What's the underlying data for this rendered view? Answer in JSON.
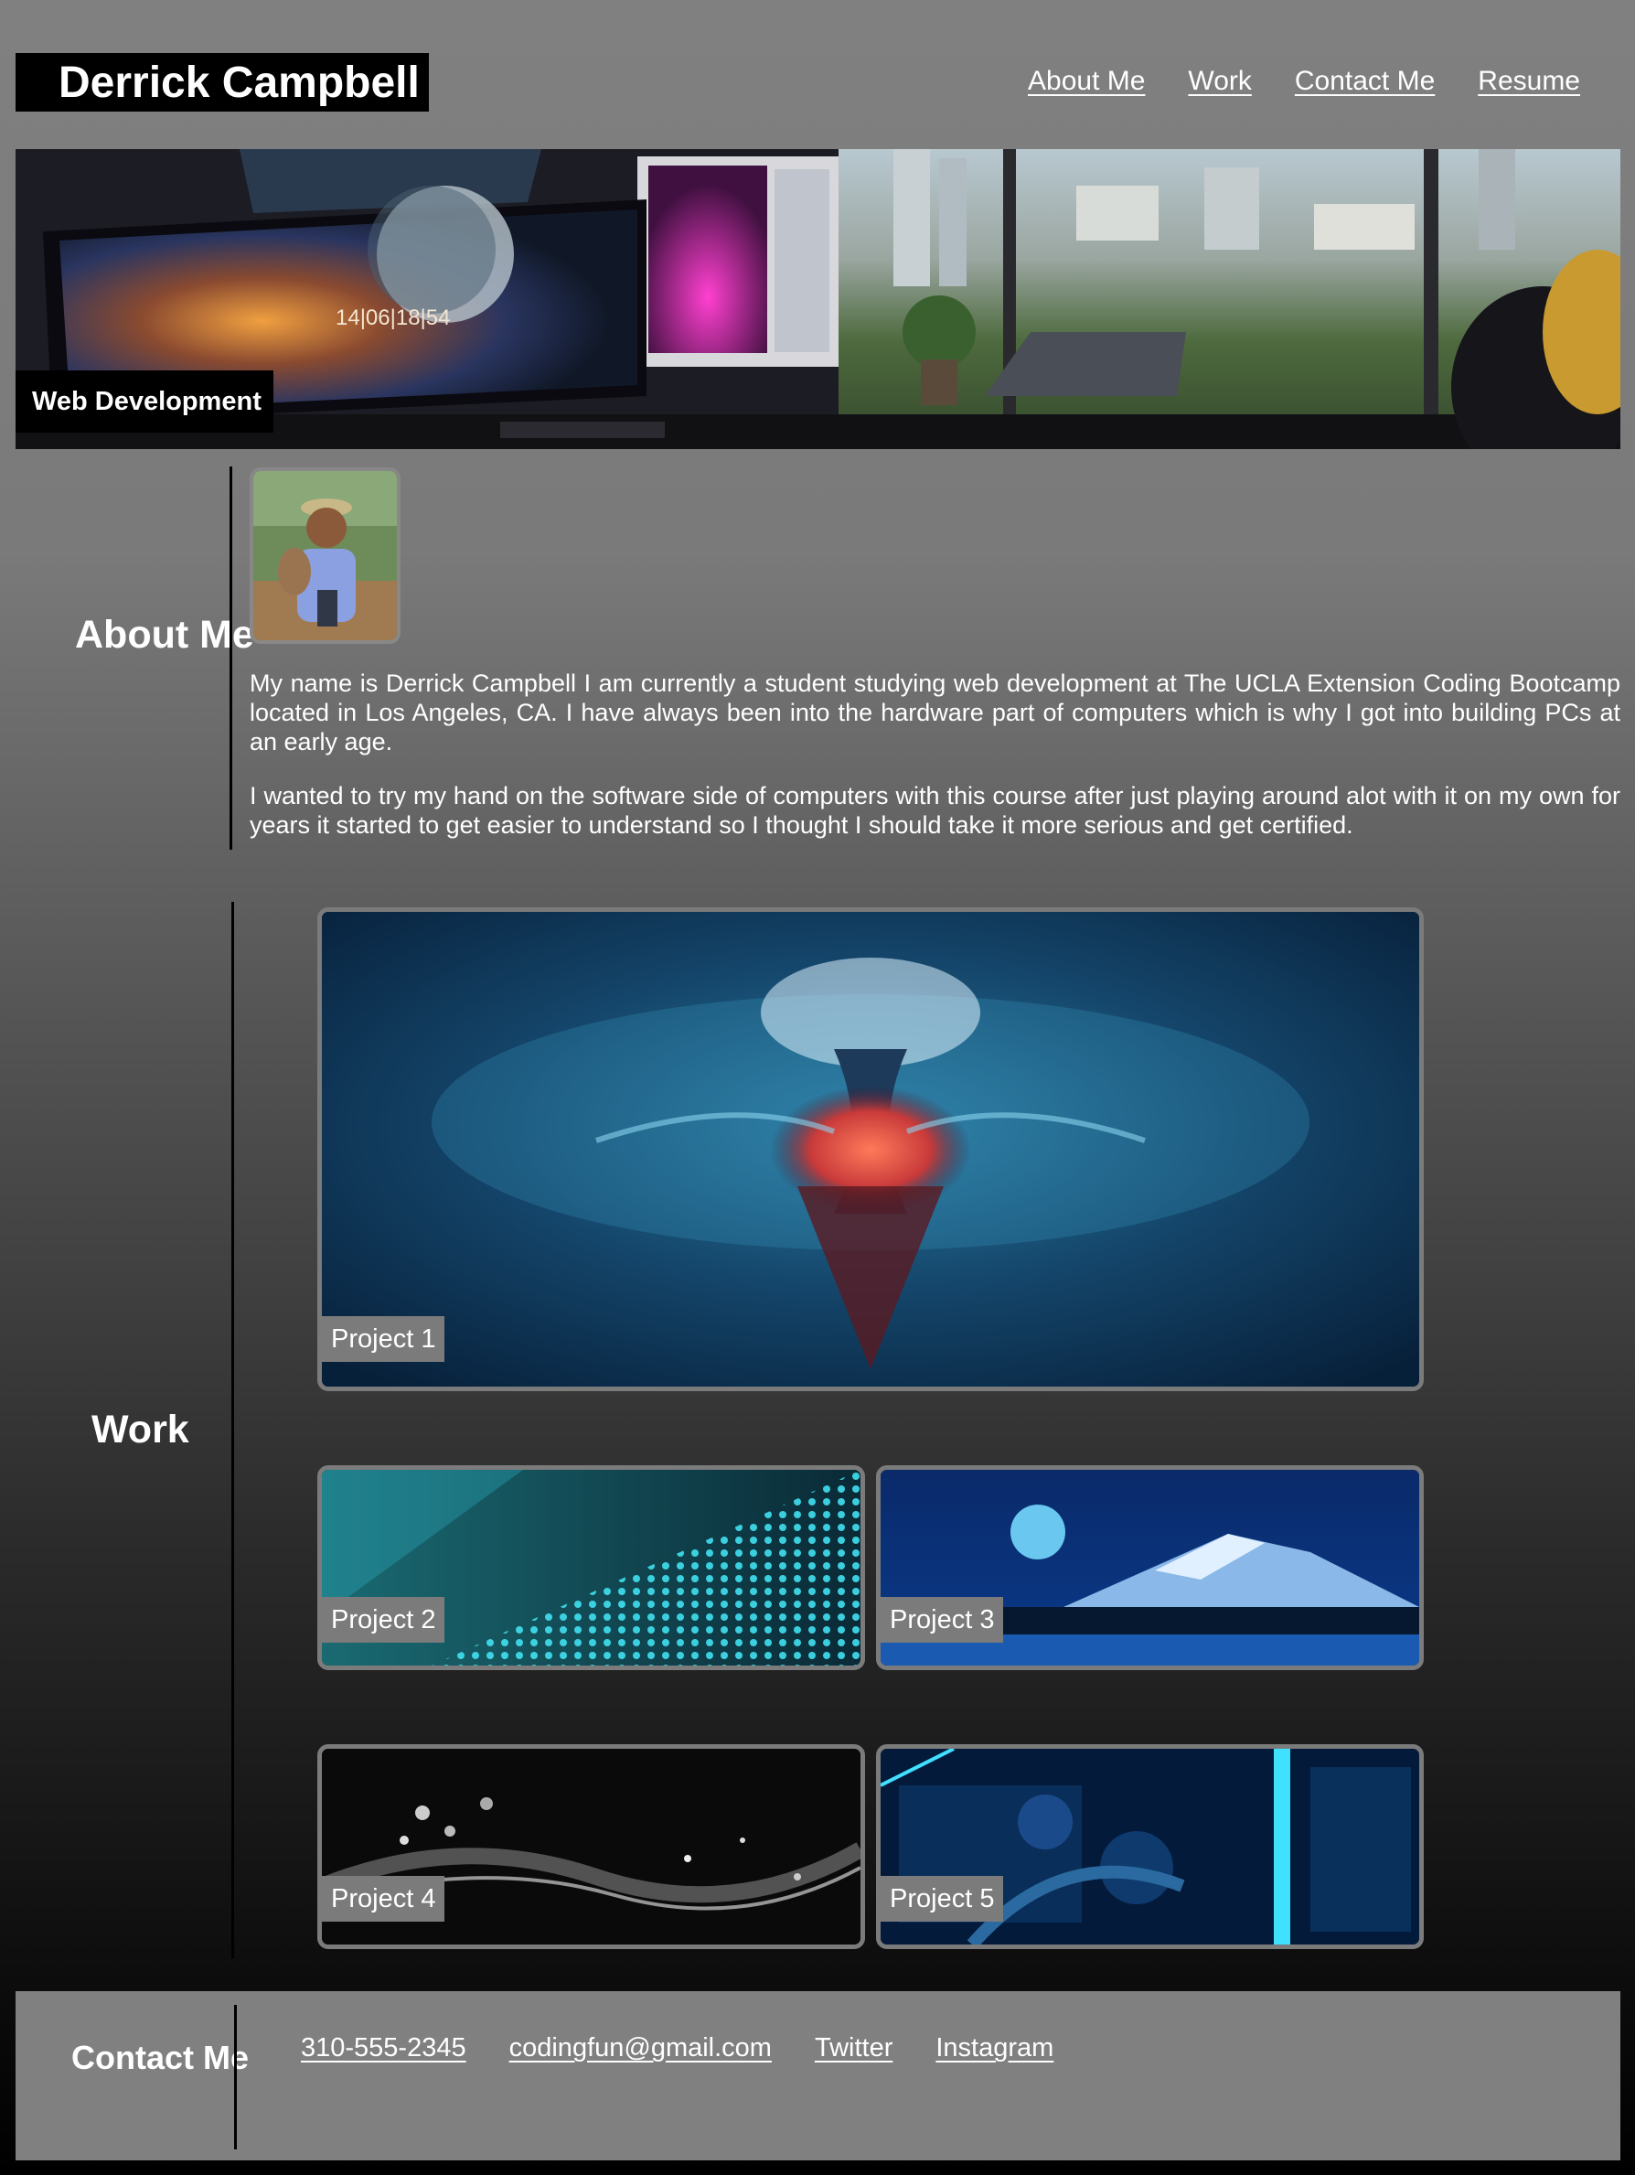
{
  "header": {
    "title": "Derrick Campbell",
    "nav": [
      "About Me",
      "Work",
      "Contact Me",
      "Resume"
    ]
  },
  "hero": {
    "label": "Web Development",
    "clock_text": "14|06|18|54"
  },
  "about": {
    "heading": "About Me",
    "paragraphs": [
      "My name is Derrick Campbell I am currently a student studying web development at The UCLA Extension Coding Bootcamp located in Los Angeles, CA. I have always been into the hardware part of computers which is why I got into building PCs at an early age.",
      "I wanted to try my hand on the software side of computers with this course after just playing around alot with it on my own for years it started to get easier to understand so I thought I should take it more serious and get certified."
    ]
  },
  "work": {
    "heading": "Work",
    "projects": [
      "Project 1",
      "Project 2",
      "Project 3",
      "Project 4",
      "Project 5"
    ]
  },
  "contact": {
    "heading": "Contact Me",
    "links": [
      "310-555-2345",
      "codingfun@gmail.com",
      "Twitter",
      "Instagram"
    ]
  },
  "colors": {
    "card_border": "#7b7b7b",
    "footer_bg": "#808080",
    "brand_bg": "#000000"
  }
}
